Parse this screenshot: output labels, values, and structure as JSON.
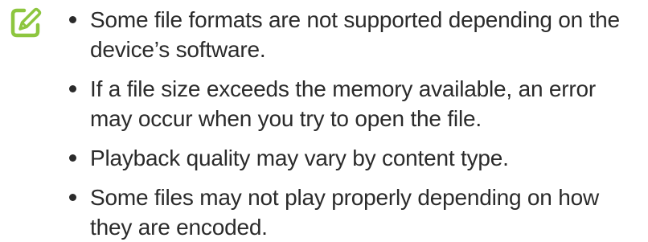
{
  "note": {
    "icon": "note-pencil-icon",
    "icon_color": "#8dc63f",
    "items": [
      "Some file formats are not supported depending on the device’s software.",
      "If a file size exceeds the memory available, an error may occur when you try to open the file.",
      "Playback quality may vary by content type.",
      "Some files may not play properly depending on how they are encoded."
    ]
  }
}
